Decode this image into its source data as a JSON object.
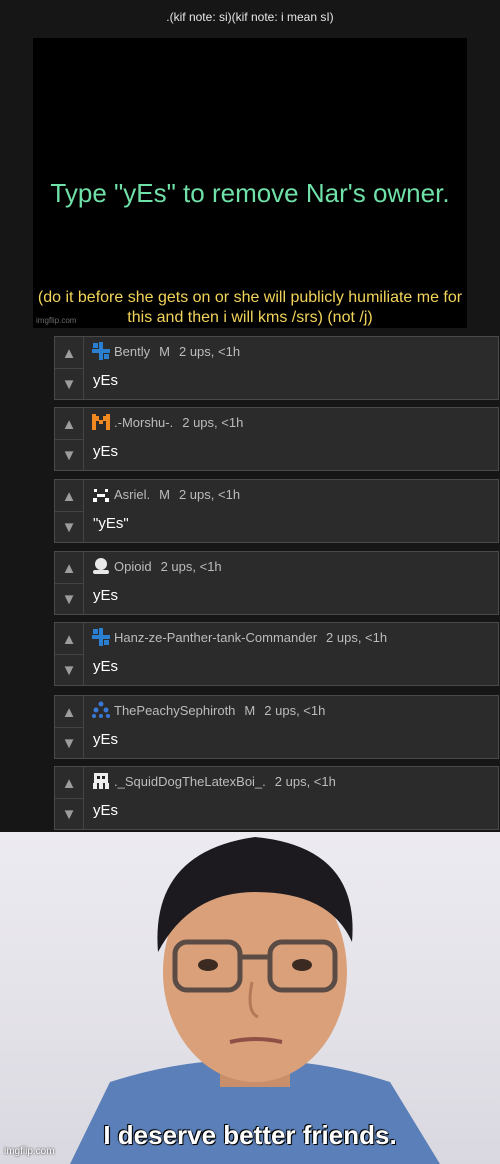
{
  "page": {
    "title": ".(kif note: si)(kif note: i mean sI)"
  },
  "post_image": {
    "headline": "Type \"yEs\" to remove Nar's owner.",
    "subline": "(do it before she gets on or she will publicly humiliate me for this and then i will kms /srs) (not /j)",
    "watermark": "imgflip.com"
  },
  "comments": [
    {
      "user": "Bently",
      "mod": "M",
      "points": "2 ups, <1h",
      "text": "yEs",
      "icon": "blue-cross-icon"
    },
    {
      "user": ".-Morshu-.",
      "mod": "",
      "points": "2 ups, <1h",
      "text": "yEs",
      "icon": "orange-m-icon"
    },
    {
      "user": "Asriel.",
      "mod": "M",
      "points": "2 ups, <1h",
      "text": "\"yEs\"",
      "icon": "white-face-icon"
    },
    {
      "user": "Opioid",
      "mod": "",
      "points": "2 ups, <1h",
      "text": "yEs",
      "icon": "default-person-icon"
    },
    {
      "user": "Hanz-ze-Panther-tank-Commander",
      "mod": "",
      "points": "2 ups, <1h",
      "text": "yEs",
      "icon": "blue-cross-icon"
    },
    {
      "user": "ThePeachySephiroth",
      "mod": "M",
      "points": "2 ups, <1h",
      "text": "yEs",
      "icon": "blue-dots-icon"
    },
    {
      "user": "._SquidDogTheLatexBoi_.",
      "mod": "",
      "points": "2 ups, <1h",
      "text": "yEs",
      "icon": "white-creature-icon"
    }
  ],
  "vote": {
    "up_icon": "upvote-arrow-icon",
    "down_icon": "downvote-arrow-icon"
  },
  "meme": {
    "caption": "I deserve better friends.",
    "watermark": "imgflip.com"
  },
  "colors": {
    "headline": "#6fe0a8",
    "subline": "#f2d45a",
    "comment_bg": "#2b2b2b",
    "avatar_blue": "#2a7fd0",
    "avatar_orange": "#f08a20"
  }
}
